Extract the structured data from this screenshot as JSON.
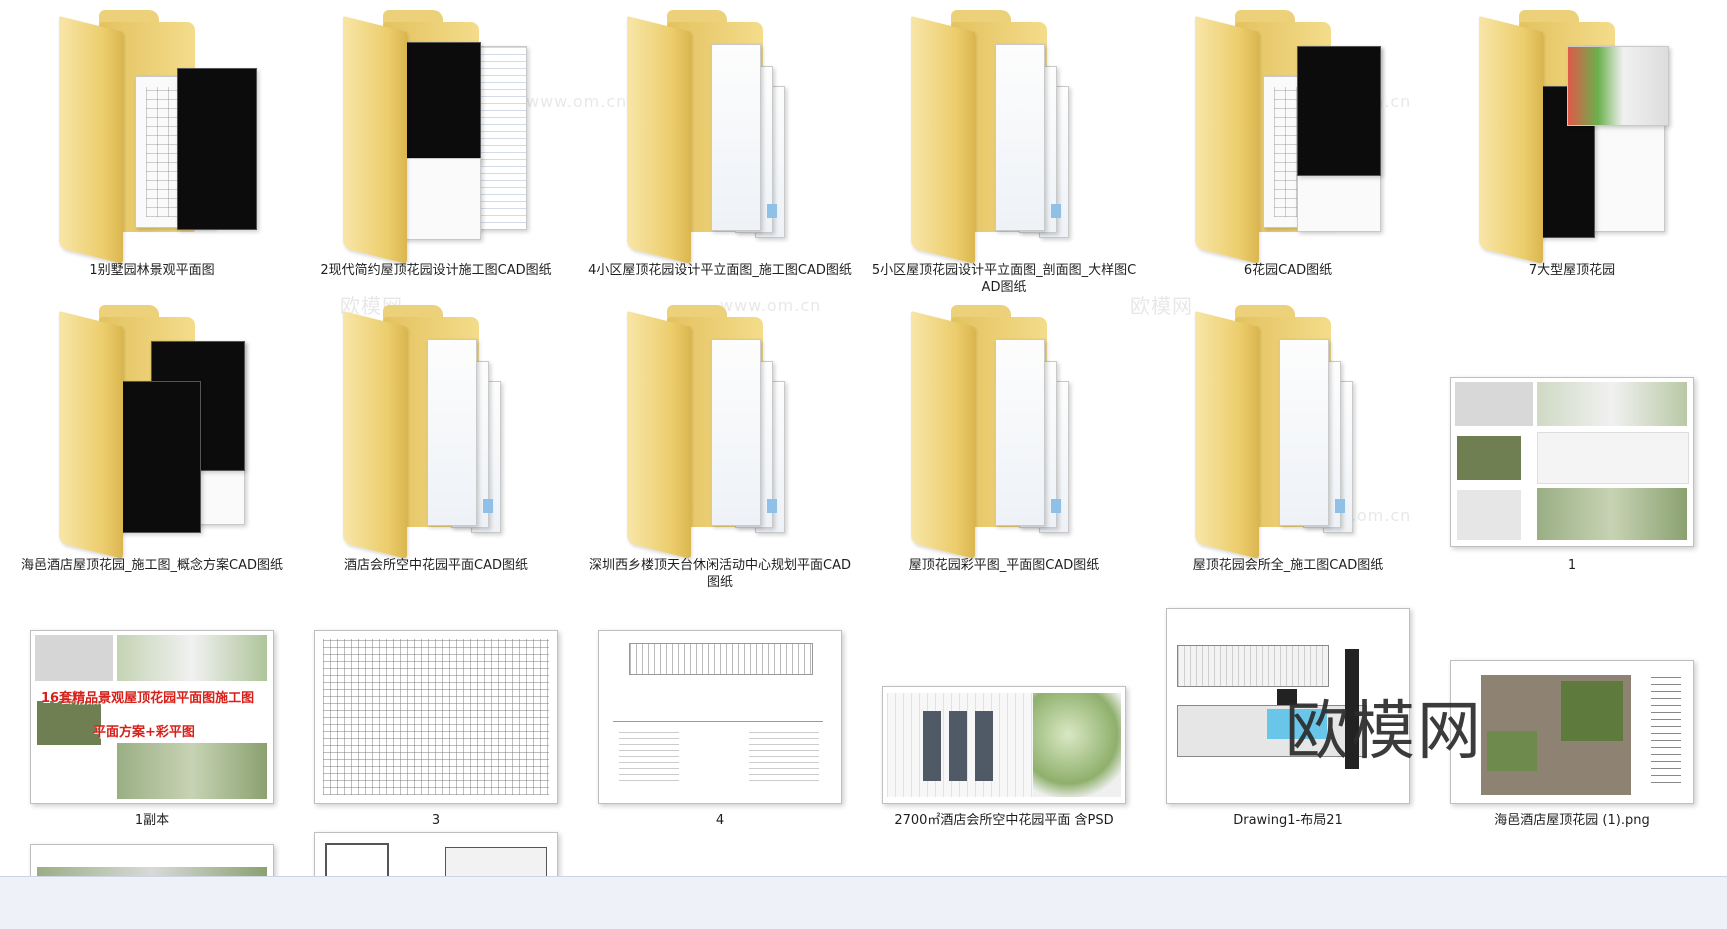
{
  "files": [
    {
      "label": "1别墅园林景观平面图"
    },
    {
      "label": "2现代简约屋顶花园设计施工图CAD图纸"
    },
    {
      "label": "4小区屋顶花园设计平立面图_施工图CAD图纸"
    },
    {
      "label": "5小区屋顶花园设计平立面图_剖面图_大样图CAD图纸"
    },
    {
      "label": "6花园CAD图纸"
    },
    {
      "label": "7大型屋顶花园"
    },
    {
      "label": "海邑酒店屋顶花园_施工图_概念方案CAD图纸"
    },
    {
      "label": "酒店会所空中花园平面CAD图纸"
    },
    {
      "label": "深圳西乡楼顶天台休闲活动中心规划平面CAD图纸"
    },
    {
      "label": "屋顶花园彩平图_平面图CAD图纸"
    },
    {
      "label": "屋顶花园会所全_施工图CAD图纸"
    },
    {
      "label": "1"
    },
    {
      "label": "1副本"
    },
    {
      "label": "3"
    },
    {
      "label": "4"
    },
    {
      "label": "2700㎡酒店会所空中花园平面 含PSD"
    },
    {
      "label": "Drawing1-布局21"
    },
    {
      "label": "海邑酒店屋顶花园 (1).png"
    }
  ],
  "thumbnail_text": {
    "red_title": "16套精品景观屋顶花园平面图施工图",
    "red_subtitle": "平面方案+彩平图"
  },
  "watermark": {
    "logo_text": "欧模网",
    "ghost_text": "欧模网",
    "ghost_url": "www.om.cn"
  }
}
